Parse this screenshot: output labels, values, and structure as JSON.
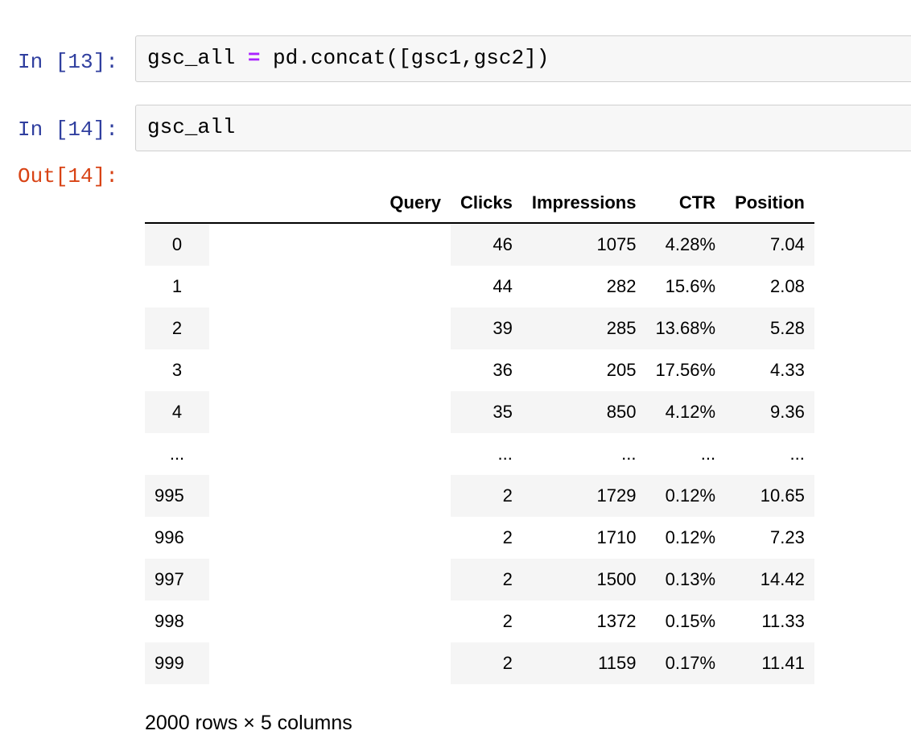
{
  "cells": [
    {
      "prompt": "In [13]:",
      "code_parts": [
        "gsc_all ",
        "=",
        " pd.concat([gsc1,gsc2])"
      ]
    },
    {
      "prompt": "In [14]:",
      "code": "gsc_all"
    }
  ],
  "output_prompt": "Out[14]:",
  "table": {
    "headers": [
      "",
      "Query",
      "Clicks",
      "Impressions",
      "CTR",
      "Position"
    ],
    "rows": [
      {
        "index": "0",
        "query": "",
        "clicks": "46",
        "impressions": "1075",
        "ctr": "4.28%",
        "position": "7.04"
      },
      {
        "index": "1",
        "query": "",
        "clicks": "44",
        "impressions": "282",
        "ctr": "15.6%",
        "position": "2.08"
      },
      {
        "index": "2",
        "query": "",
        "clicks": "39",
        "impressions": "285",
        "ctr": "13.68%",
        "position": "5.28"
      },
      {
        "index": "3",
        "query": "",
        "clicks": "36",
        "impressions": "205",
        "ctr": "17.56%",
        "position": "4.33"
      },
      {
        "index": "4",
        "query": "",
        "clicks": "35",
        "impressions": "850",
        "ctr": "4.12%",
        "position": "9.36"
      },
      {
        "index": "...",
        "query": "",
        "clicks": "...",
        "impressions": "...",
        "ctr": "...",
        "position": "..."
      },
      {
        "index": "995",
        "query": "",
        "clicks": "2",
        "impressions": "1729",
        "ctr": "0.12%",
        "position": "10.65"
      },
      {
        "index": "996",
        "query": "",
        "clicks": "2",
        "impressions": "1710",
        "ctr": "0.12%",
        "position": "7.23"
      },
      {
        "index": "997",
        "query": "",
        "clicks": "2",
        "impressions": "1500",
        "ctr": "0.13%",
        "position": "14.42"
      },
      {
        "index": "998",
        "query": "",
        "clicks": "2",
        "impressions": "1372",
        "ctr": "0.15%",
        "position": "11.33"
      },
      {
        "index": "999",
        "query": "",
        "clicks": "2",
        "impressions": "1159",
        "ctr": "0.17%",
        "position": "11.41"
      }
    ]
  },
  "footer": "2000 rows × 5 columns",
  "colors": {
    "in_prompt": "#303f9f",
    "out_prompt": "#d84315",
    "operator": "#aa22ff",
    "cell_bg": "#f7f7f7",
    "stripe": "#f5f5f5"
  }
}
